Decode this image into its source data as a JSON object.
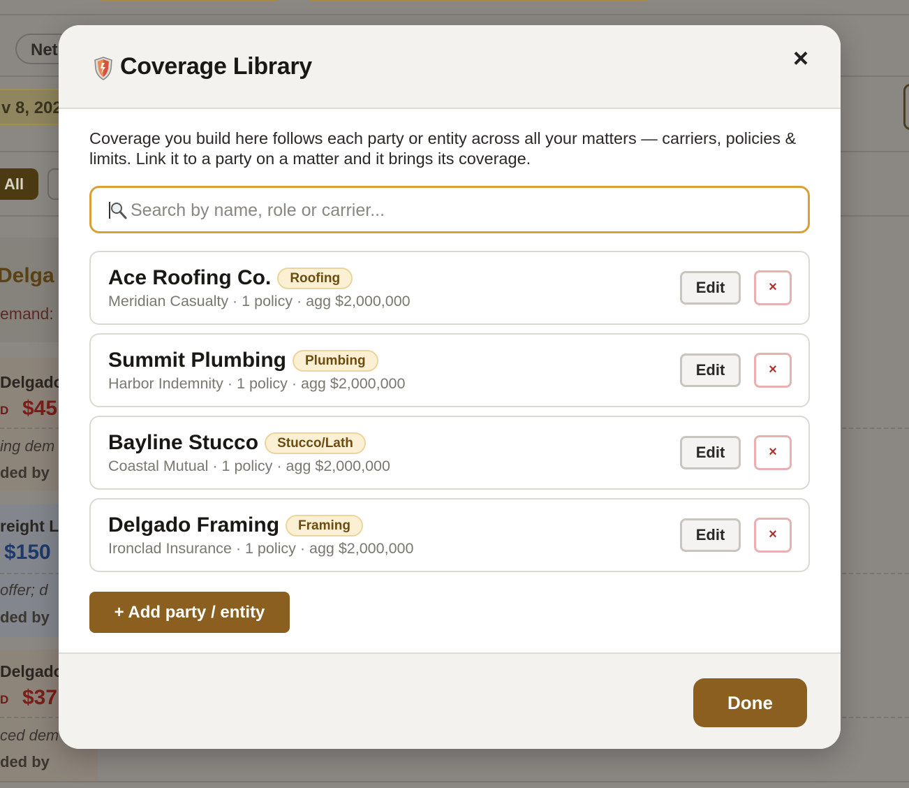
{
  "background": {
    "chip_net": "Net",
    "date_chip": "v 8, 202",
    "filter_all": "All",
    "heading_partial": "Delga",
    "demand_partial": "emand:",
    "rows": [
      {
        "name": "Delgado",
        "badge": "D",
        "amount": "$45",
        "note": "ing dem",
        "by": "ded by"
      },
      {
        "name": "reight L",
        "badge": "",
        "amount": "$150",
        "note": "offer; d",
        "by": "ded by"
      },
      {
        "name": "Delgado",
        "badge": "D",
        "amount": "$37",
        "note": "ced dem",
        "by": "ded by"
      }
    ]
  },
  "modal": {
    "title": "Coverage Library",
    "icon": "shield-icon",
    "close_label": "×",
    "intro": "Coverage you build here follows each party or entity across all your matters — carriers, policies & limits. Link it to a party on a matter and it brings its coverage.",
    "search": {
      "placeholder": "Search by name, role or carrier...",
      "value": ""
    },
    "entities": [
      {
        "name": "Ace Roofing Co.",
        "tag": "Roofing",
        "summary": "Meridian Casualty · 1 policy · agg $2,000,000",
        "edit_label": "Edit",
        "delete_label": "×"
      },
      {
        "name": "Summit Plumbing",
        "tag": "Plumbing",
        "summary": "Harbor Indemnity · 1 policy · agg $2,000,000",
        "edit_label": "Edit",
        "delete_label": "×"
      },
      {
        "name": "Bayline Stucco",
        "tag": "Stucco/Lath",
        "summary": "Coastal Mutual · 1 policy · agg $2,000,000",
        "edit_label": "Edit",
        "delete_label": "×"
      },
      {
        "name": "Delgado Framing",
        "tag": "Framing",
        "summary": "Ironclad Insurance · 1 policy · agg $2,000,000",
        "edit_label": "Edit",
        "delete_label": "×"
      }
    ],
    "add_label": "+ Add party / entity",
    "done_label": "Done"
  },
  "colors": {
    "accent": "#8a5f1f",
    "search_border": "#d9a034",
    "tag_bg": "#fbf0d3",
    "delete_red": "#b0312c"
  }
}
